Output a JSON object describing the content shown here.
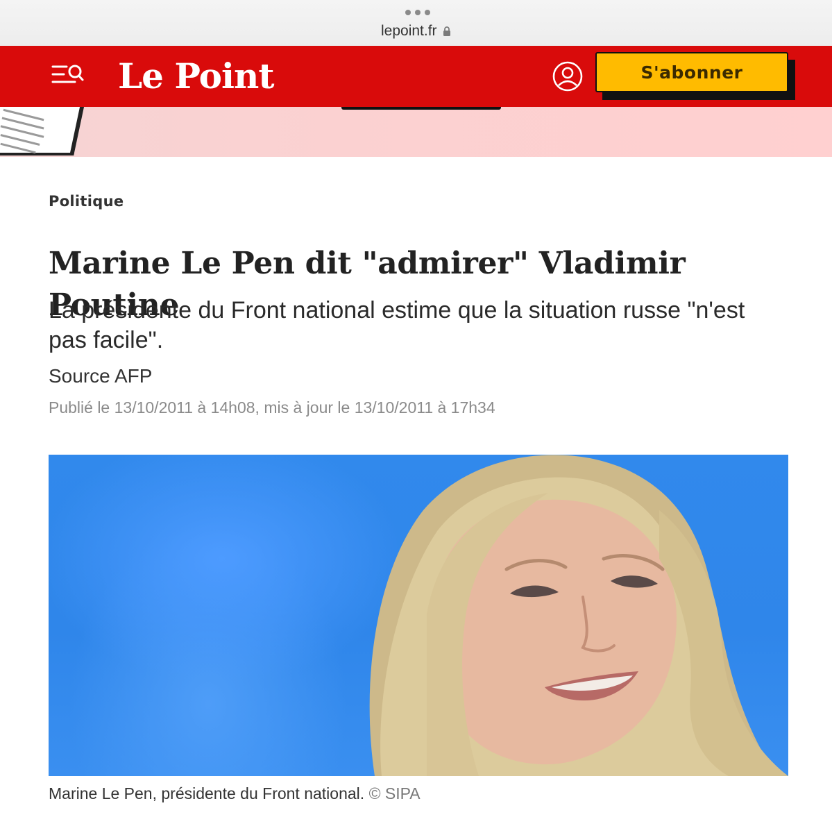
{
  "browser": {
    "url": "lepoint.fr"
  },
  "header": {
    "logo": "Le Point",
    "subscribe_label": "S'abonner"
  },
  "article": {
    "rubric": "Politique",
    "title": "Marine Le Pen dit \"admirer\" Vladimir Poutine",
    "standfirst": "La présidente du Front national estime que la situation russe \"n'est pas facile\".",
    "source": "Source AFP",
    "dates": "Publié le 13/10/2011 à 14h08, mis à jour le 13/10/2011 à 17h34",
    "caption": "Marine Le Pen, présidente du Front national.",
    "credit": "© SIPA"
  },
  "colors": {
    "brand_red": "#d90b0b",
    "subscribe_yellow": "#ffbb00"
  },
  "icons": [
    "menu-search-icon",
    "account-icon",
    "lock-icon",
    "tab-dots-icon"
  ]
}
